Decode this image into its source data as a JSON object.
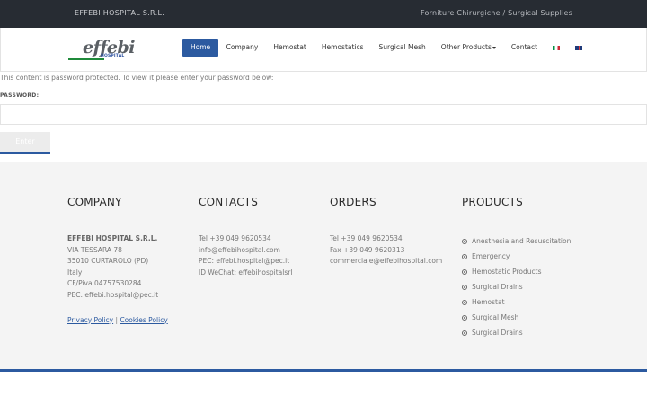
{
  "topbar": {
    "company": "EFFEBI HOSPITAL S.R.L.",
    "tagline": "Forniture Chirurgiche / Surgical Supplies"
  },
  "logo": {
    "word": "effebi",
    "sub": "HOSPITAL"
  },
  "nav": {
    "items": [
      "Home",
      "Company",
      "Hemostat",
      "Hemostatics",
      "Surgical Mesh",
      "Other Products",
      "Contact"
    ],
    "active": "Home",
    "languages": [
      "it",
      "en"
    ]
  },
  "protect": {
    "message": "This content is password protected. To view it please enter your password below:",
    "label": "PASSWORD:",
    "button": "Enter"
  },
  "footer": {
    "company": {
      "heading": "COMPANY",
      "name": "EFFEBI HOSPITAL S.R.L.",
      "lines": [
        "VIA TESSARA 78",
        "35010 CURTAROLO (PD)",
        "Italy",
        "CF/Piva 04757530284",
        "PEC: effebi.hospital@pec.it"
      ],
      "privacy": "Privacy Policy",
      "separator": "|",
      "cookies": "Cookies Policy"
    },
    "contacts": {
      "heading": "CONTACTS",
      "lines": [
        "Tel +39 049 9620534",
        "info@effebihospital.com",
        "PEC: effebi.hospital@pec.it",
        "ID WeChat: effebihospitalsrl"
      ]
    },
    "orders": {
      "heading": "ORDERS",
      "lines": [
        "Tel +39 049 9620534",
        "Fax +39 049 9620313",
        "commerciale@effebihospital.com"
      ]
    },
    "products": {
      "heading": "PRODUCTS",
      "items": [
        "Anesthesia and Resuscitation",
        "Emergency",
        "Hemostatic Products",
        "Surgical Drains",
        "Hemostat",
        "Surgical Mesh",
        "Surgical Drains"
      ]
    }
  },
  "colors": {
    "accent": "#2c5aa0",
    "topbar": "#272c33",
    "footer_bg": "#f4f4f4"
  }
}
